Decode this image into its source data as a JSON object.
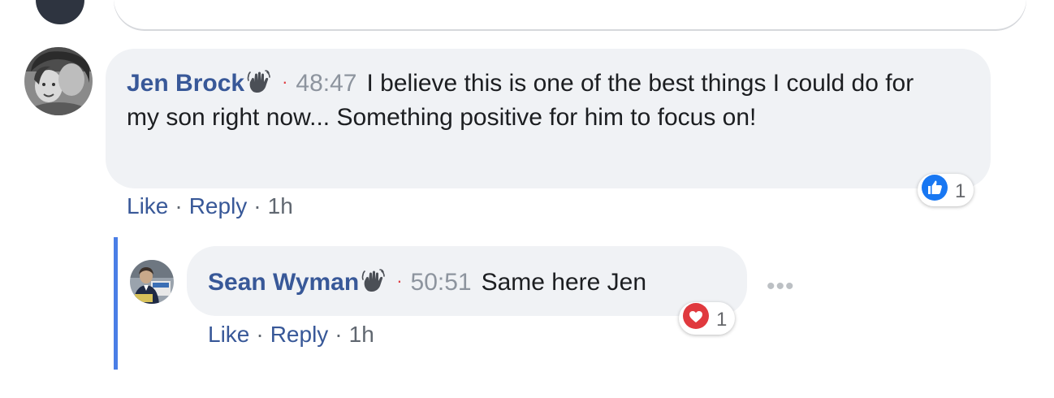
{
  "colors": {
    "link": "#385898",
    "bubble": "#f0f2f5",
    "thread_line": "#4a7ee6",
    "like_blue": "#1877f2",
    "love_red": "#e0393e"
  },
  "comments": [
    {
      "author": "Jen Brock",
      "badge_icon": "waving-hand-icon",
      "separator": "·",
      "timestamp": "48:47",
      "text": "I believe this is one of the best things I could do for my son right now... Something positive for him to focus on!",
      "reaction_icon": "like-icon",
      "reaction_count": "1",
      "actions": {
        "like": "Like",
        "reply": "Reply",
        "dot": "·",
        "time": "1h"
      }
    },
    {
      "author": "Sean Wyman",
      "badge_icon": "waving-hand-icon",
      "separator": "·",
      "timestamp": "50:51",
      "text": "Same here Jen",
      "reaction_icon": "love-icon",
      "reaction_count": "1",
      "actions": {
        "like": "Like",
        "reply": "Reply",
        "dot": "·",
        "time": "1h"
      },
      "more_icon": "more-options-icon",
      "more_label": "•••"
    }
  ]
}
